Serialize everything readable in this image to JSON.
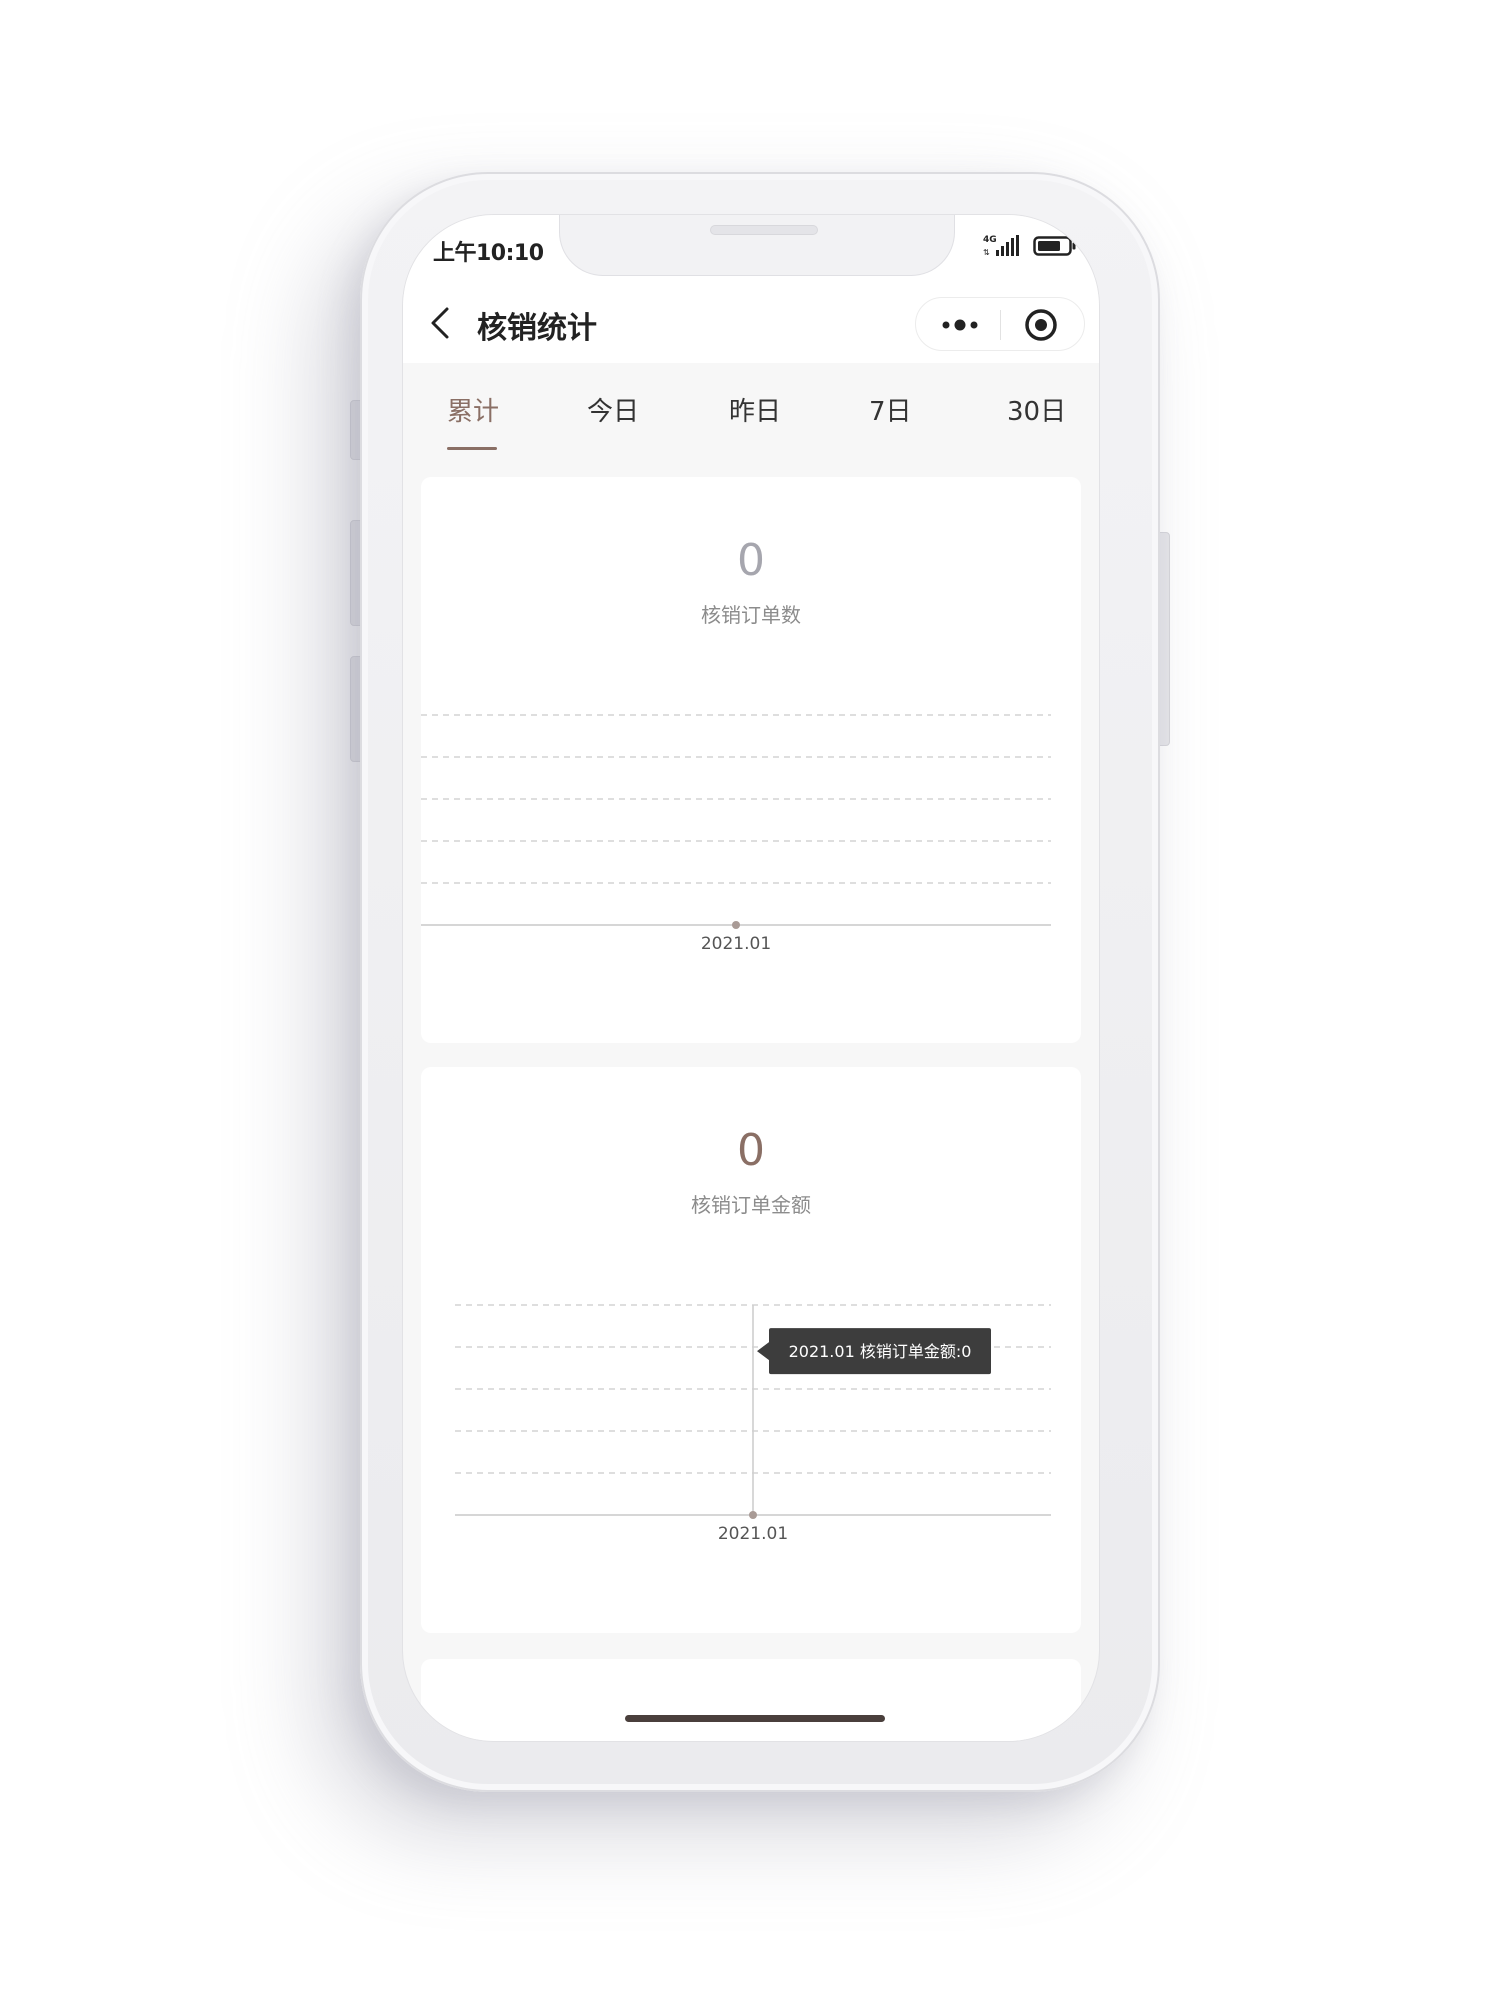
{
  "status": {
    "time": "上午10:10",
    "network": "4G"
  },
  "nav": {
    "title": "核销统计"
  },
  "tabs": [
    {
      "label": "累计",
      "active": true
    },
    {
      "label": "今日",
      "active": false
    },
    {
      "label": "昨日",
      "active": false
    },
    {
      "label": "7日",
      "active": false
    },
    {
      "label": "30日",
      "active": false
    }
  ],
  "cards": [
    {
      "value": "0",
      "label": "核销订单数"
    },
    {
      "value": "0",
      "label": "核销订单金额"
    }
  ],
  "chart_data": [
    {
      "type": "line",
      "categories": [
        "2021.01"
      ],
      "series": [
        {
          "values": [
            0
          ]
        }
      ],
      "grid": true
    },
    {
      "type": "line",
      "categories": [
        "2021.01"
      ],
      "series": [
        {
          "values": [
            0
          ]
        }
      ],
      "grid": true,
      "tooltip": "2021.01 核销订单金额:0"
    }
  ],
  "colors": {
    "accent": "#8a6f65",
    "grid": "#d4d4d4",
    "tooltip_bg": "#3d3d3d"
  }
}
